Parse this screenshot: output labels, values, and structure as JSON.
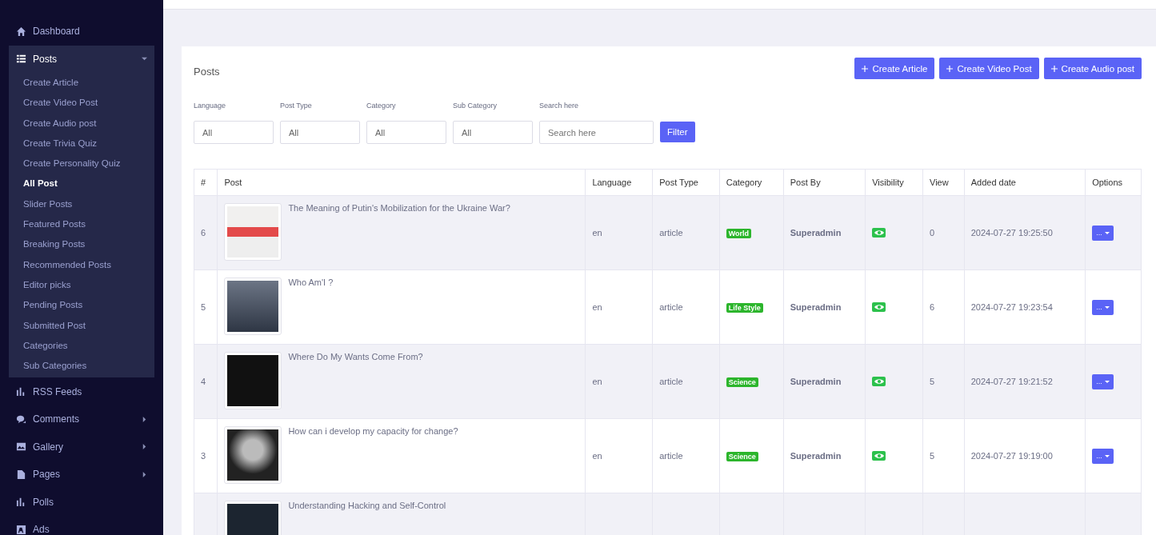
{
  "sidebar": {
    "items": [
      {
        "label": "Dashboard"
      },
      {
        "label": "Posts",
        "expanded": true,
        "children": [
          {
            "label": "Create Article",
            "selected": false
          },
          {
            "label": "Create Video Post",
            "selected": false
          },
          {
            "label": "Create Audio post",
            "selected": false
          },
          {
            "label": "Create Trivia Quiz",
            "selected": false
          },
          {
            "label": "Create Personality Quiz",
            "selected": false
          },
          {
            "label": "All Post",
            "selected": true
          },
          {
            "label": "Slider Posts",
            "selected": false
          },
          {
            "label": "Featured Posts",
            "selected": false
          },
          {
            "label": "Breaking Posts",
            "selected": false
          },
          {
            "label": "Recommended Posts",
            "selected": false
          },
          {
            "label": "Editor picks",
            "selected": false
          },
          {
            "label": "Pending Posts",
            "selected": false
          },
          {
            "label": "Submitted Post",
            "selected": false
          },
          {
            "label": "Categories",
            "selected": false
          },
          {
            "label": "Sub Categories",
            "selected": false
          }
        ]
      },
      {
        "label": "RSS Feeds"
      },
      {
        "label": "Comments",
        "expanded": false
      },
      {
        "label": "Gallery",
        "expanded": false
      },
      {
        "label": "Pages",
        "expanded": false
      },
      {
        "label": "Polls"
      },
      {
        "label": "Ads"
      }
    ]
  },
  "page": {
    "title": "Posts",
    "actions": [
      "Create Article",
      "Create Video Post",
      "Create Audio post"
    ]
  },
  "filters": [
    {
      "label": "Language",
      "value": "All",
      "kind": "select"
    },
    {
      "label": "Post Type",
      "value": "All",
      "kind": "select"
    },
    {
      "label": "Category",
      "value": "All",
      "kind": "select"
    },
    {
      "label": "Sub Category",
      "value": "All",
      "kind": "select"
    },
    {
      "label": "Search here",
      "placeholder": "Search here",
      "kind": "search"
    }
  ],
  "filter_button": "Filter",
  "table": {
    "columns": [
      "#",
      "Post",
      "Language",
      "Post Type",
      "Category",
      "Post By",
      "Visibility",
      "View",
      "Added date",
      "Options"
    ],
    "rows": [
      {
        "id": "6",
        "title": "The Meaning of Putin's Mobilization for the Ukraine War?",
        "language": "en",
        "type": "article",
        "category": "World",
        "author": "Superadmin",
        "visible": true,
        "views": "0",
        "date": "2024-07-27 19:25:50",
        "options": "..."
      },
      {
        "id": "5",
        "title": "Who Am'I ?",
        "language": "en",
        "type": "article",
        "category": "Life Style",
        "author": "Superadmin",
        "visible": true,
        "views": "6",
        "date": "2024-07-27 19:23:54",
        "options": "..."
      },
      {
        "id": "4",
        "title": "Where Do My Wants Come From?",
        "language": "en",
        "type": "article",
        "category": "Science",
        "author": "Superadmin",
        "visible": true,
        "views": "5",
        "date": "2024-07-27 19:21:52",
        "options": "..."
      },
      {
        "id": "3",
        "title": "How can i develop my capacity for change?",
        "language": "en",
        "type": "article",
        "category": "Science",
        "author": "Superadmin",
        "visible": true,
        "views": "5",
        "date": "2024-07-27 19:19:00",
        "options": "..."
      },
      {
        "title": "Understanding Hacking and Self-Control"
      }
    ]
  }
}
